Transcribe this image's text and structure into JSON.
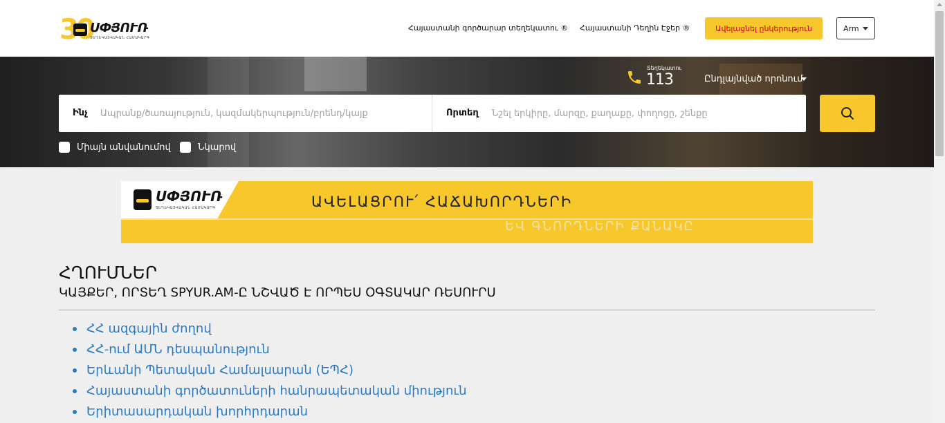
{
  "header": {
    "logo": {
      "number": "30",
      "wordmark": "ՍՓՅՈՒՌ",
      "tagline": "ՏԵՂԵԿԱՏՎԱԿԱՆ ՀԱՄԱԿԱՐԳ"
    },
    "nav": [
      {
        "label": "Հայաստանի գործարար տեղեկատու ®"
      },
      {
        "label": "Հայաստանի Դեղին Էջեր ®"
      }
    ],
    "cta_label": "Ավելացնել ընկերություն",
    "language": "Arm"
  },
  "hero": {
    "hotline": {
      "label": "Տեղեկատու",
      "number": "113"
    },
    "advanced_search": "Ընդլայնված որոնում",
    "search": {
      "what_label": "Ինչ",
      "what_placeholder": "Ապրանք/ծառայություն, կազմակերպություն/բրենդ/կայք",
      "where_label": "Որտեղ",
      "where_placeholder": "Նշել երկիրը, մարզը, քաղաքը, փողոցը, շենքը"
    },
    "filters": [
      {
        "label": "Միայն անվանումով"
      },
      {
        "label": "Նկարով"
      }
    ]
  },
  "banner": {
    "wordmark": "ՍՓՅՈՒՌ",
    "tagline": "ՏԵՂԵԿԱՏՎԱԿԱՆ ՀԱՄԱԿԱՐԳ",
    "line1": "ԱՎԵԼԱՑՐՈՒ՛ ՀԱՃԱԽՈՐԴՆԵՐԻ",
    "line2": "ԵՎ ԳՆՈՐԴՆԵՐԻ ՔԱՆԱԿԸ"
  },
  "content": {
    "title": "ՀՂՈՒՄՆԵՐ",
    "subtitle": "ԿԱՅՔԵՐ, ՈՐՏԵՂ SPYUR.AM-Ը ՆՇՎԱԾ Է ՈՐՊԵՍ ՕԳՏԱԿԱՐ ՌԵՍՈՒՐՍ",
    "links": [
      "ՀՀ ազգային ժողով",
      "ՀՀ-ում ԱՄՆ դեսպանություն",
      "Երևանի Պետական Համալսարան (ԵՊՀ)",
      "Հայաստանի գործատուների հանրապետական միություն",
      "Երիտասարդական խորհրդարան"
    ]
  },
  "colors": {
    "accent": "#f8c72b",
    "link": "#2b79c5",
    "cta_text": "#cc0000"
  },
  "icons": [
    "phone-icon",
    "search-icon",
    "caret-down-icon",
    "checkbox-icon"
  ]
}
